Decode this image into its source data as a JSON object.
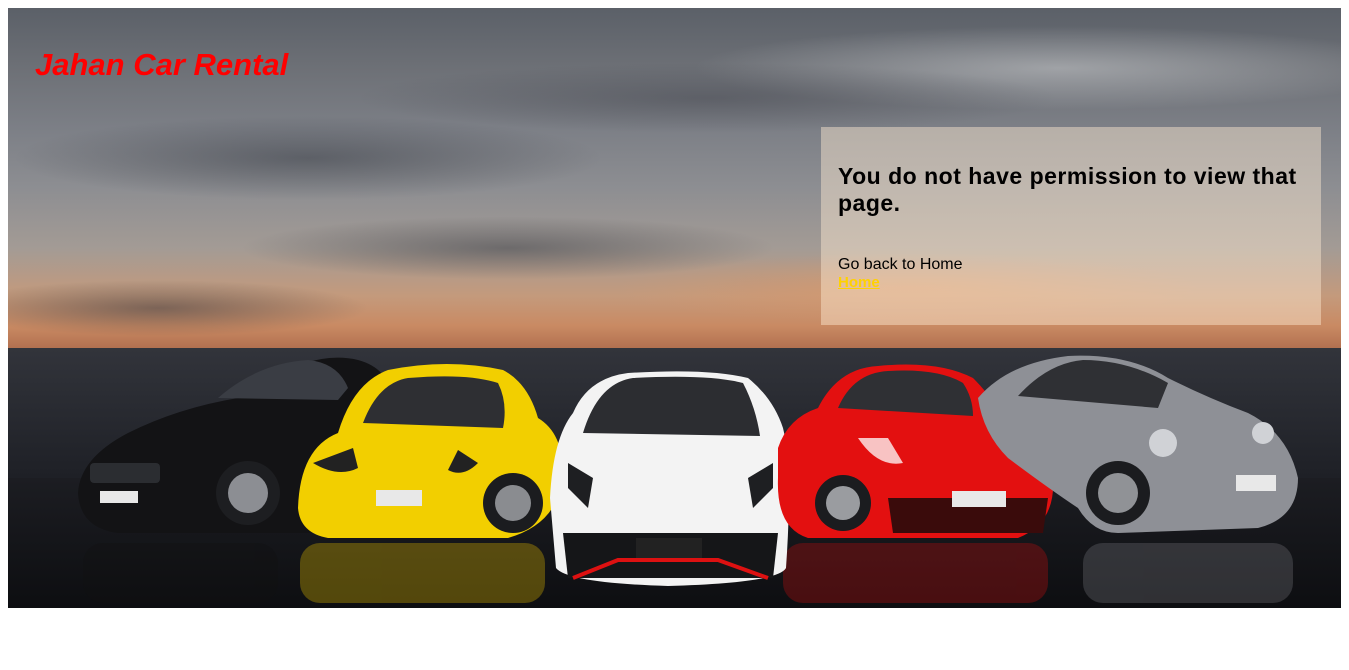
{
  "brand": {
    "title": "Jahan Car Rental"
  },
  "hero": {
    "image": "cars-lineup-background",
    "car_colors": [
      "#111111",
      "#f2cf00",
      "#f3f3f3",
      "#e31010",
      "#8e9096"
    ]
  },
  "notice": {
    "message": "You do not have permission to view that page.",
    "go_back_text": "Go back to Home",
    "home_link_label": "Home"
  },
  "colors": {
    "brand": "#ff0000",
    "link": "#ffd200"
  }
}
